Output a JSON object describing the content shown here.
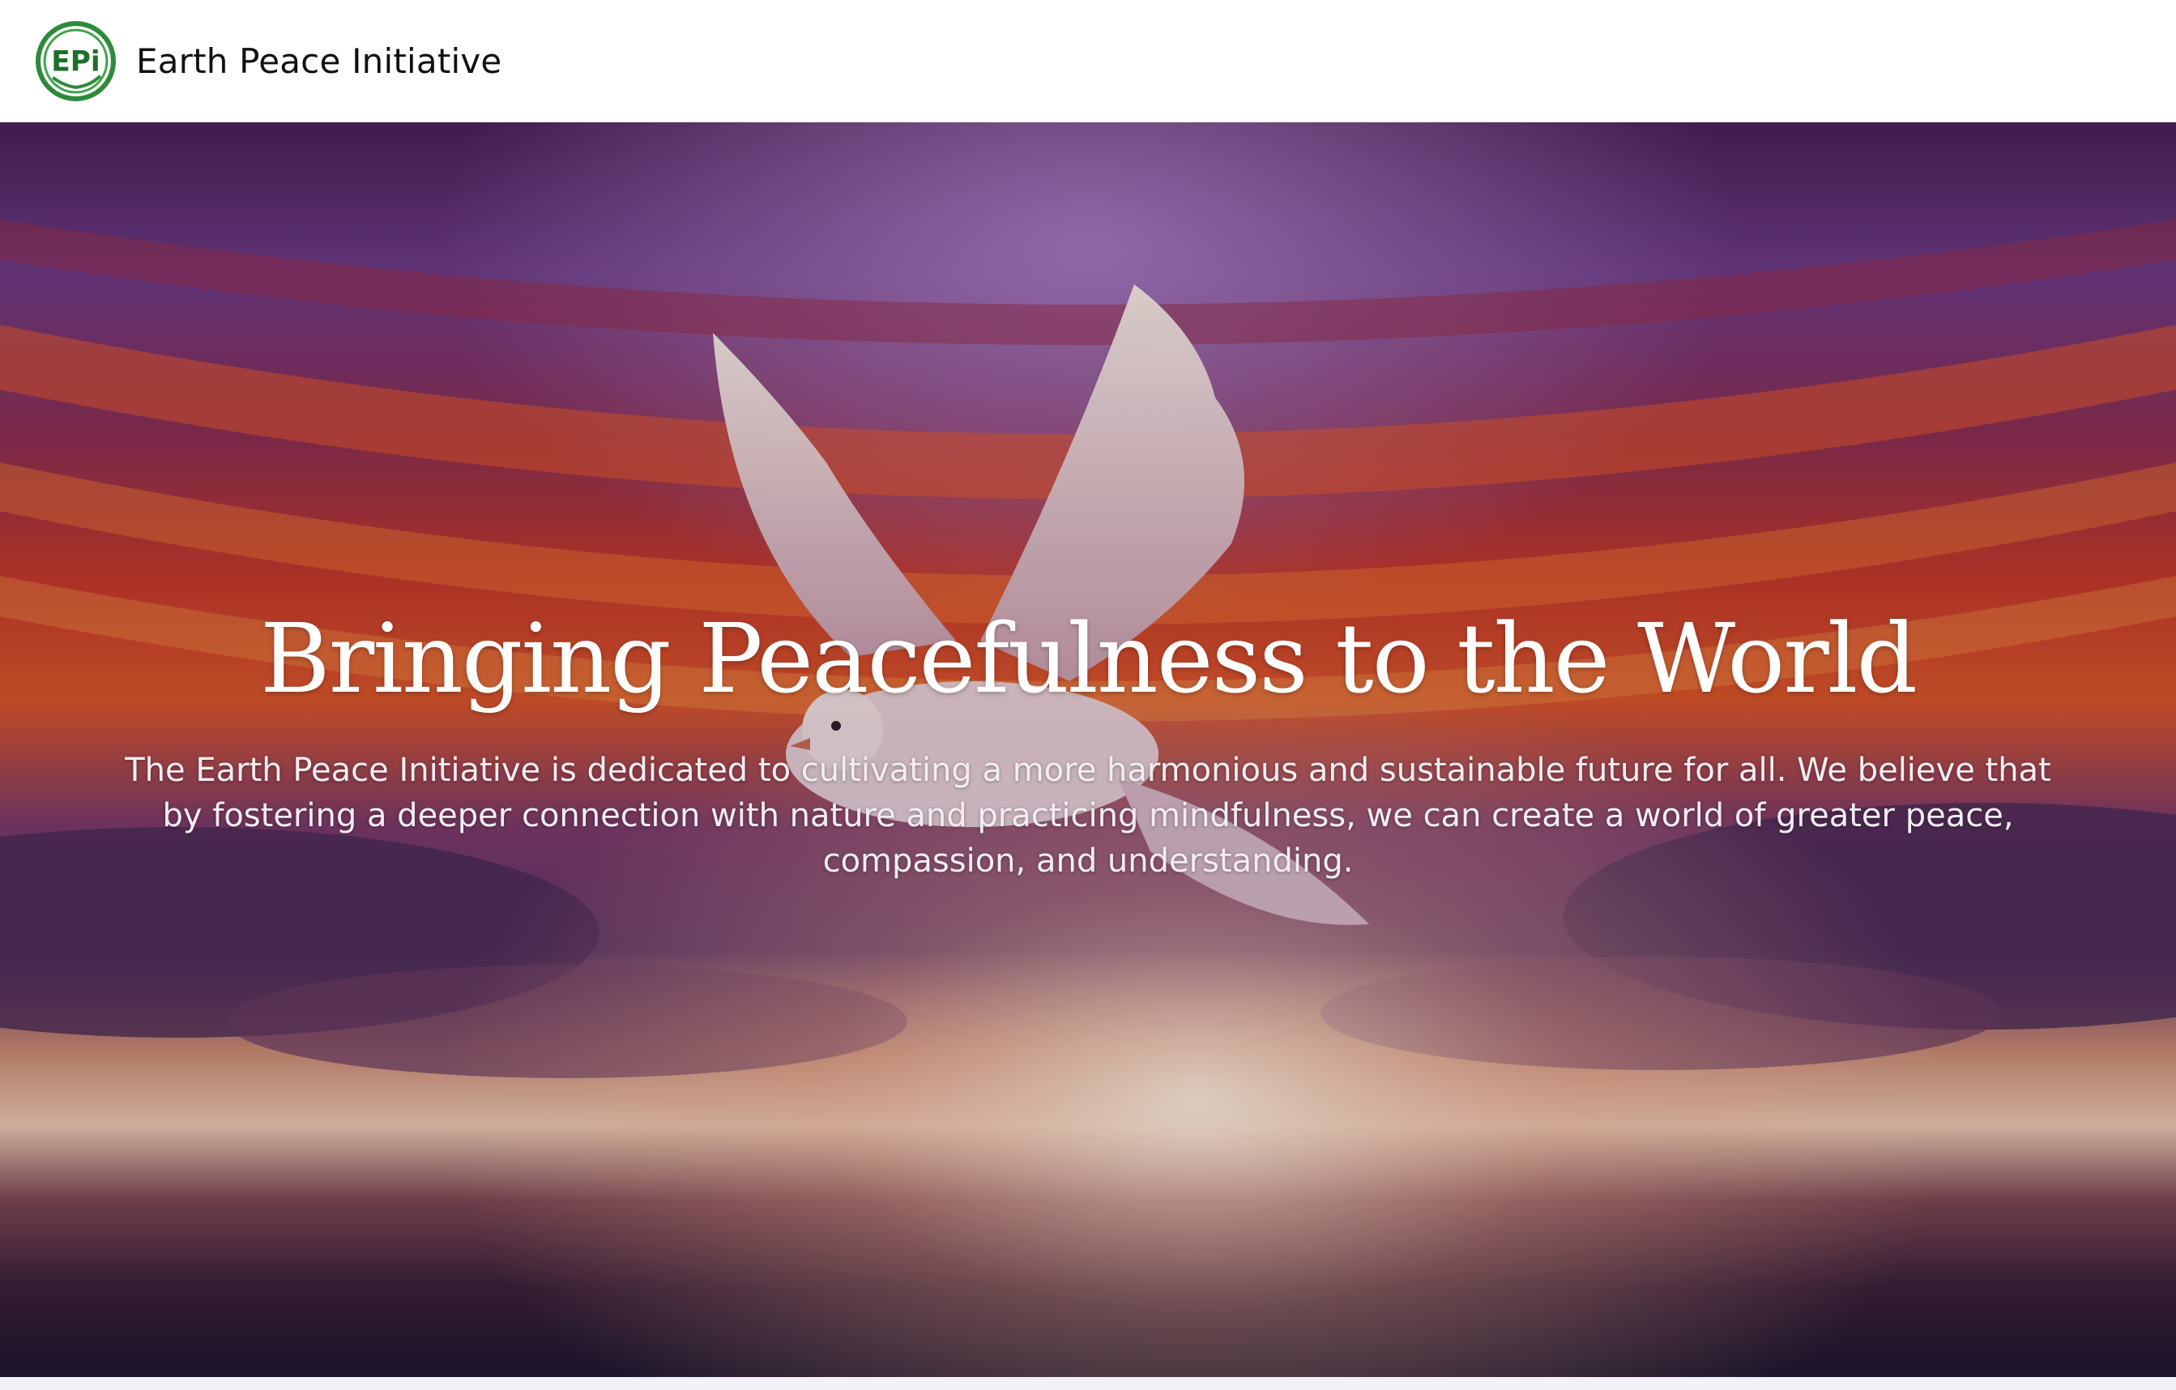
{
  "header": {
    "logo_text": "EPi",
    "site_name": "Earth Peace Initiative"
  },
  "hero": {
    "title": "Bringing Peacefulness to the World",
    "description": "The Earth Peace Initiative is dedicated to cultivating a more harmonious and sustainable future for all. We believe that by fostering a deeper connection with nature and practicing mindfulness, we can create a world of greater peace, compassion, and understanding.",
    "background_image": "dove-flying-over-sunset-sky"
  },
  "colors": {
    "logo_green": "#2e8b3a",
    "sky_purple": "#5b2a6e",
    "sky_red": "#b5302f",
    "sky_orange": "#e86a2a",
    "nav_background": "#ffffff"
  }
}
